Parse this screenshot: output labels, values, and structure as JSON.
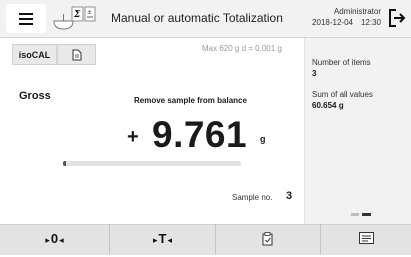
{
  "header": {
    "menu_icon": "hamburger-menu-icon",
    "app_icon": "totalization-scale-sigma-icon",
    "title": "Manual or automatic Totalization",
    "user": "Administrator",
    "date": "2018-12-04",
    "time": "12:30",
    "logout_icon": "logout-icon"
  },
  "tabs": [
    {
      "label": "isoCAL"
    },
    {
      "icon": "document-icon"
    }
  ],
  "balance": {
    "max_info": "Max 620 g   d = 0.001 g",
    "mode": "Gross",
    "instruction": "Remove sample from balance",
    "sign": "+",
    "value": "9.761",
    "unit": "g",
    "capacity_fraction": 0.016
  },
  "sample": {
    "label": "Sample no.",
    "value": "3"
  },
  "side_panel": {
    "items_label": "Number of items",
    "items_value": "3",
    "sum_label": "Sum of all values",
    "sum_value": "60.654 g",
    "page_indicator": {
      "pages": 2,
      "active": 2
    }
  },
  "bottom": {
    "zero_label": "0",
    "tare_label": "T",
    "clipboard_icon": "clipboard-check-icon",
    "print_icon": "print-report-icon"
  },
  "colors": {
    "topbar_bg": "#f2f2f2",
    "side_bg": "#f2f2f2",
    "bottom_bg": "#e3e3e3",
    "text": "#1a1a1a"
  }
}
